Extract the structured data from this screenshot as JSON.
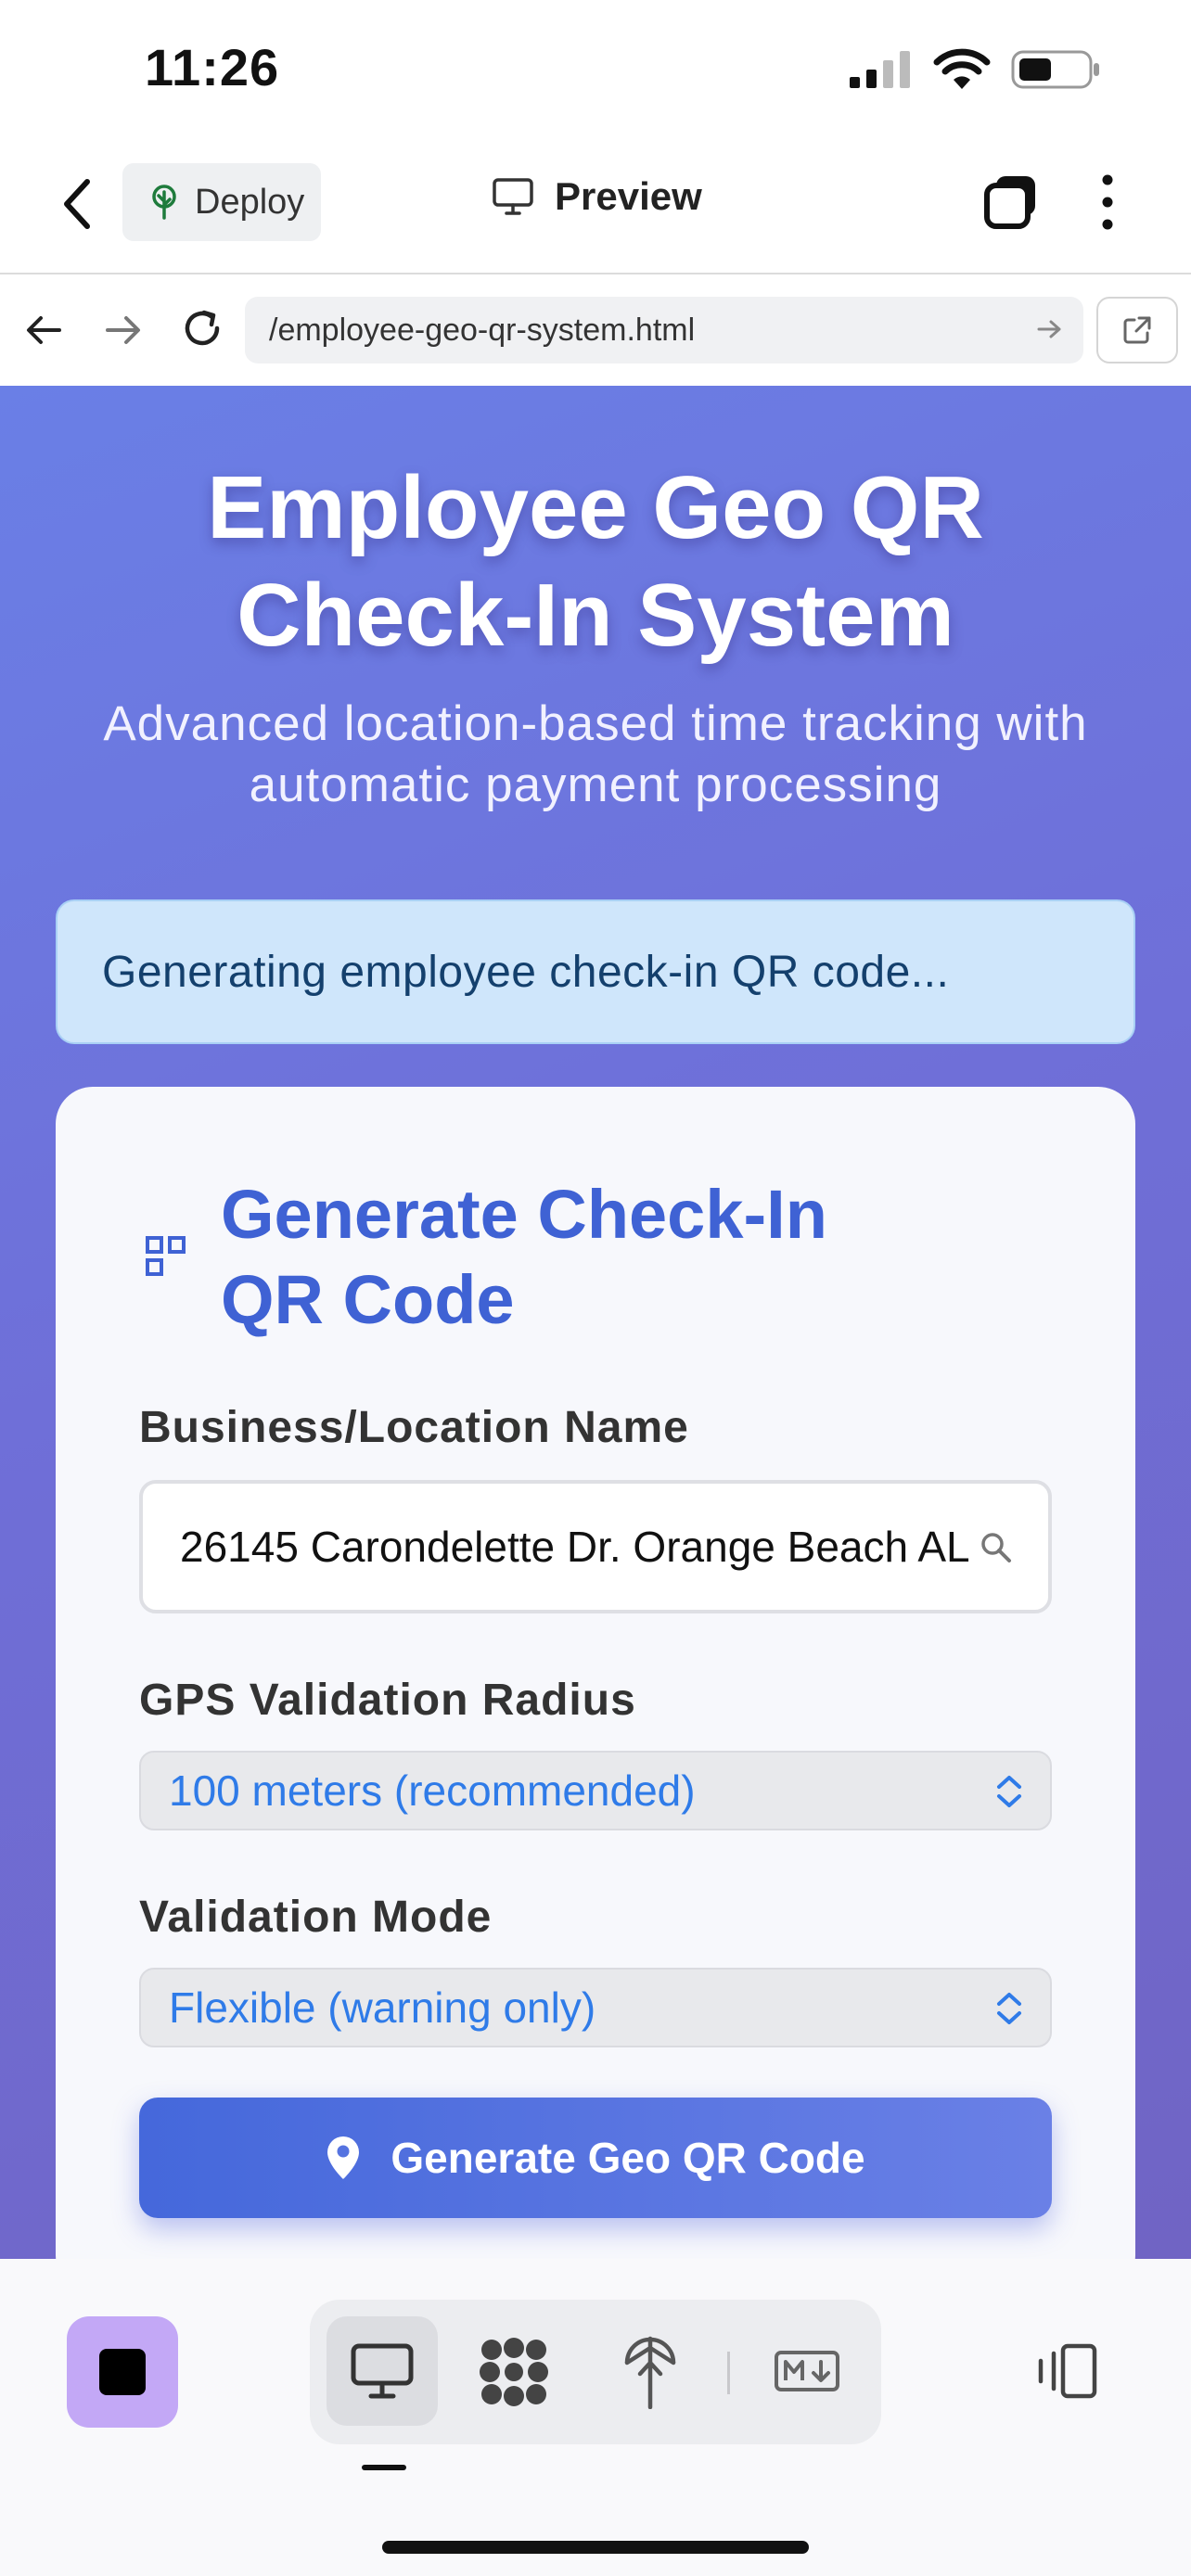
{
  "status_bar": {
    "time": "11:26"
  },
  "topbar": {
    "deploy_label": "Deploy",
    "preview_label": "Preview"
  },
  "browser": {
    "url": "/employee-geo-qr-system.html"
  },
  "hero": {
    "title_line1": "Employee Geo QR",
    "title_line2": "Check-In System",
    "subtitle_line1": "Advanced location-based time tracking with",
    "subtitle_line2": "automatic payment processing"
  },
  "notice": {
    "text": "Generating employee check-in QR code..."
  },
  "card": {
    "title_line1": "Generate Check-In",
    "title_line2": "QR Code",
    "business_label": "Business/Location Name",
    "business_value": "26145 Carondelette Dr. Orange Beach AL",
    "radius_label": "GPS Validation Radius",
    "radius_value": "100 meters (recommended)",
    "mode_label": "Validation Mode",
    "mode_value": "Flexible (warning only)",
    "generate_button": "Generate Geo QR Code"
  },
  "colors": {
    "accent": "#3f62d4",
    "gradient_start": "#6a7fe6",
    "gradient_end": "#7064c4",
    "notice_bg": "#cfe6fb",
    "select_text": "#2f7be8",
    "stop_button": "#c3a8f6"
  },
  "icons": [
    "back-chevron-icon",
    "deploy-tree-icon",
    "monitor-icon",
    "stack-icon",
    "more-vertical-icon",
    "arrow-left-icon",
    "arrow-right-icon",
    "reload-icon",
    "external-link-icon",
    "qr-icon",
    "search-icon",
    "chevron-updown-icon",
    "location-pin-icon",
    "stop-icon",
    "monitor-tab-icon",
    "grid-blob-icon",
    "antenna-icon",
    "markdown-icon",
    "split-view-icon"
  ]
}
